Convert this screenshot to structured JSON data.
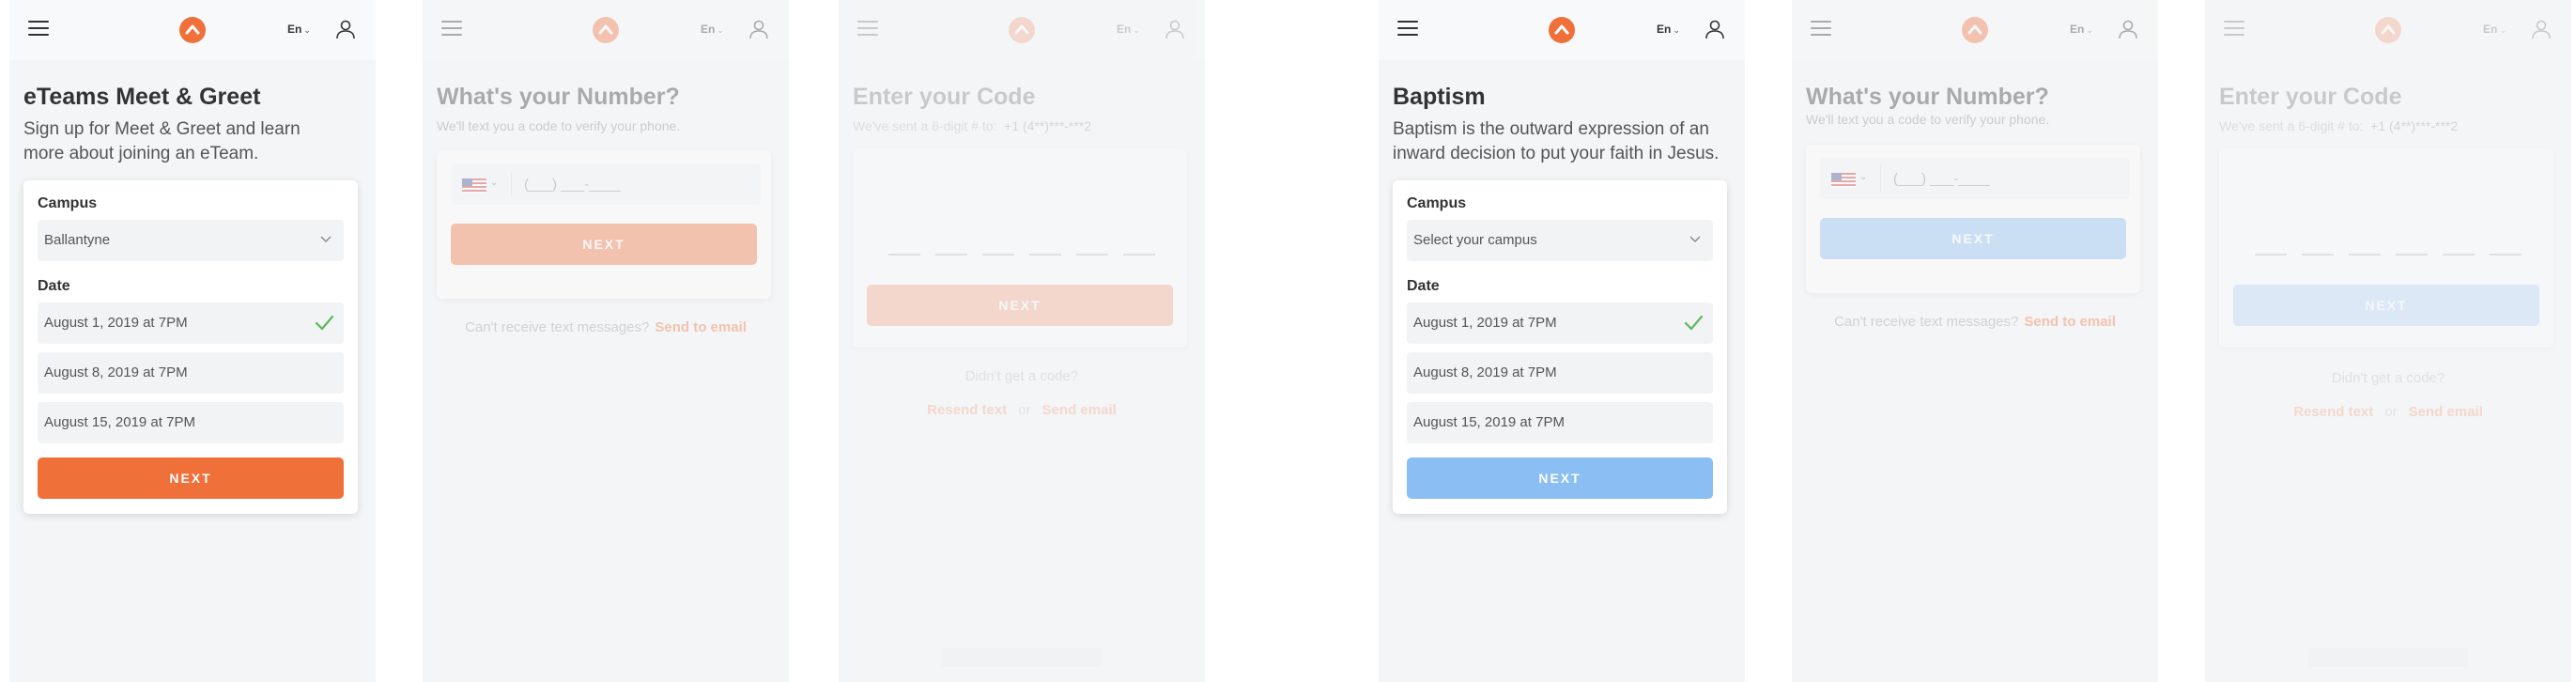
{
  "header": {
    "language": "En"
  },
  "colors": {
    "accent_orange": "#f0703a",
    "accent_blue": "#8bbef2",
    "success_green": "#5cb85c"
  },
  "screens": {
    "meet_greet": {
      "title": "eTeams Meet & Greet",
      "subtitle": "Sign up for Meet & Greet and learn more about joining an eTeam.",
      "campus_label": "Campus",
      "campus_value": "Ballantyne",
      "date_label": "Date",
      "dates": [
        "August 1, 2019 at 7PM",
        "August 8, 2019 at 7PM",
        "August 15, 2019 at 7PM"
      ],
      "next": "NEXT"
    },
    "number_1": {
      "title": "What's your Number?",
      "subtitle": "We'll text you a code to verify your phone.",
      "phone_placeholder": "(___) ___-____",
      "next": "NEXT",
      "cant_receive": "Can't receive text messages?",
      "send_to_email": "Send to email"
    },
    "code_1": {
      "title": "Enter your Code",
      "subtitle_prefix": "We've sent a 6-digit # to:",
      "masked_phone": "+1 (4**)***-***2",
      "next": "NEXT",
      "didnt_get": "Didn't get a code?",
      "resend_text": "Resend text",
      "or": "or",
      "send_email": "Send email"
    },
    "baptism": {
      "title": "Baptism",
      "subtitle": "Baptism is the outward expression of an inward decision to put your faith in Jesus.",
      "campus_label": "Campus",
      "campus_placeholder": "Select your campus",
      "date_label": "Date",
      "dates": [
        "August 1, 2019 at 7PM",
        "August 8, 2019 at 7PM",
        "August 15, 2019 at 7PM"
      ],
      "next": "NEXT"
    },
    "number_2": {
      "title": "What's your Number?",
      "subtitle": "We'll text you a code to verify your phone.",
      "phone_placeholder": "(___) ___-____",
      "next": "NEXT",
      "cant_receive": "Can't receive text messages?",
      "send_to_email": "Send to email"
    },
    "code_2": {
      "title": "Enter your Code",
      "subtitle_prefix": "We've sent a 6-digit # to:",
      "masked_phone": "+1 (4**)***-***2",
      "next": "NEXT",
      "didnt_get": "Didn't get a code?",
      "resend_text": "Resend text",
      "or": "or",
      "send_email": "Send email"
    }
  }
}
